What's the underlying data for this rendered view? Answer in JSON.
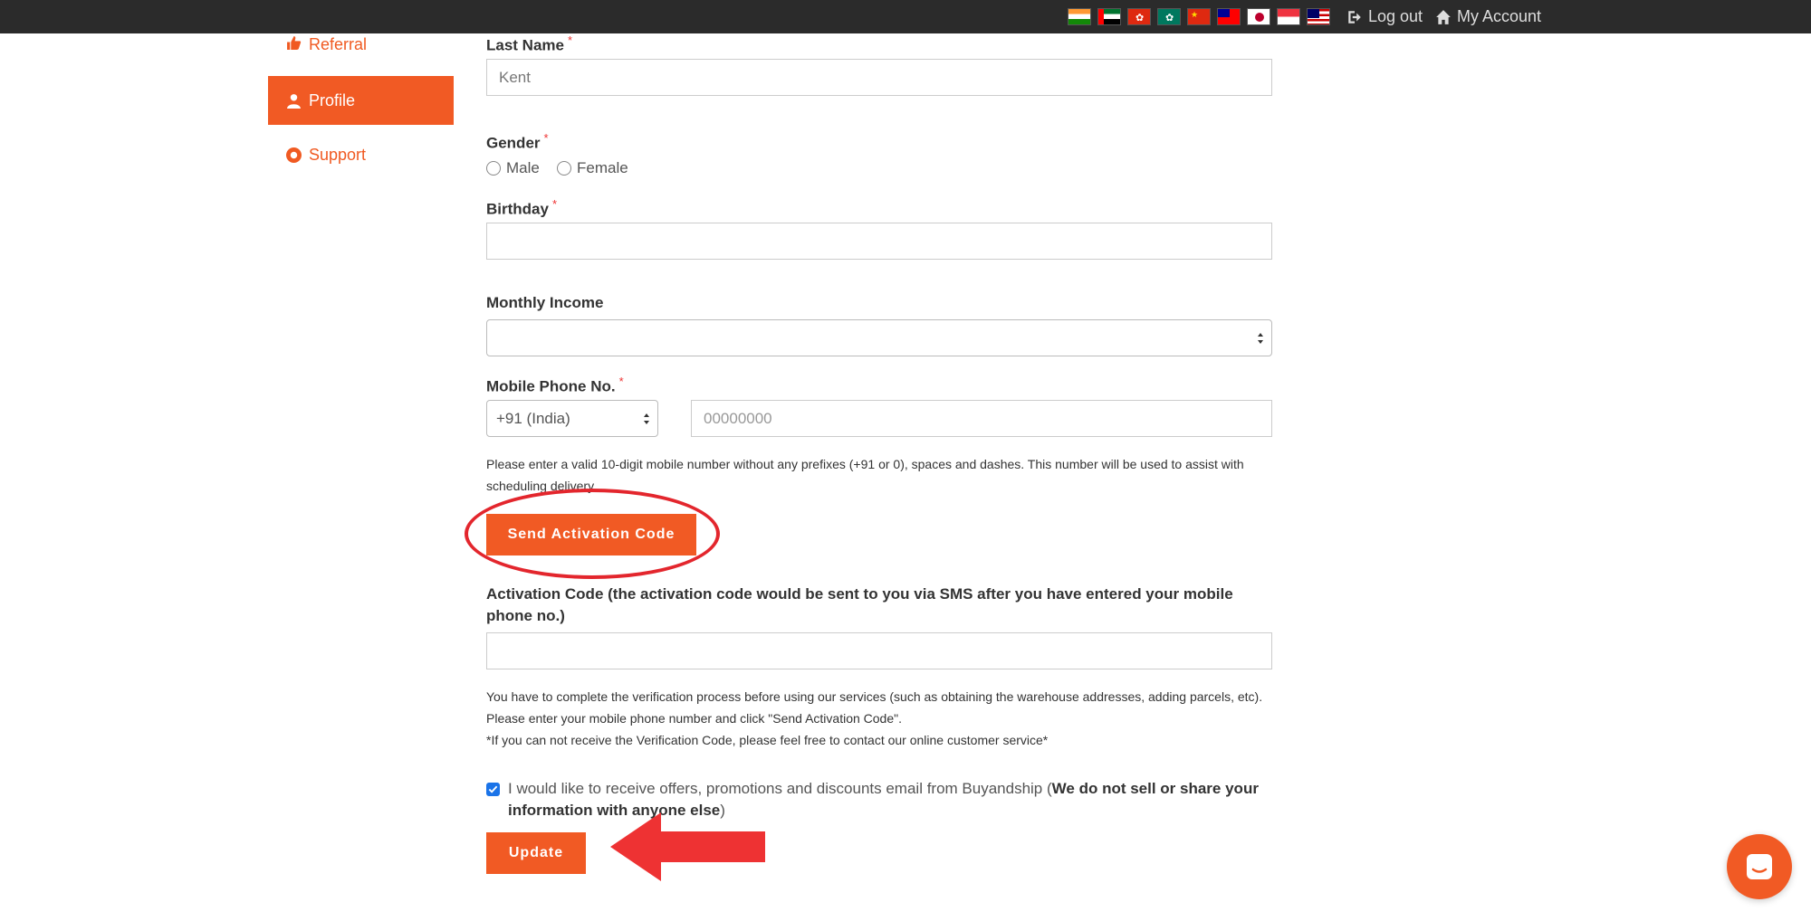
{
  "topbar": {
    "flags": [
      "flag-india-icon",
      "flag-uae-icon",
      "flag-hongkong-icon",
      "flag-macau-icon",
      "flag-china-icon",
      "flag-taiwan-icon",
      "flag-japan-icon",
      "flag-singapore-icon",
      "flag-malaysia-icon"
    ],
    "logout_label": "Log out",
    "my_account_label": "My Account"
  },
  "sidebar": {
    "items": [
      {
        "label": "Referral",
        "icon": "thumbs-up-icon"
      },
      {
        "label": "Profile",
        "icon": "user-icon",
        "active": true
      },
      {
        "label": "Support",
        "icon": "life-ring-icon"
      }
    ]
  },
  "form": {
    "last_name": {
      "label": "Last Name",
      "required": "*",
      "value": "Kent"
    },
    "gender": {
      "label": "Gender",
      "required": "*",
      "options": [
        "Male",
        "Female"
      ]
    },
    "birthday": {
      "label": "Birthday",
      "required": "*",
      "value": ""
    },
    "monthly_income": {
      "label": "Monthly Income",
      "value": ""
    },
    "mobile": {
      "label": "Mobile Phone No.",
      "required": "*",
      "country_code": "+91 (India)",
      "placeholder": "00000000",
      "help": "Please enter a valid 10-digit mobile number without any prefixes (+91 or 0), spaces and dashes. This number will be used to assist with scheduling delivery."
    },
    "send_code_button": "Send Activation Code",
    "activation_code": {
      "label": "Activation Code (the activation code would be sent to you via SMS after you have entered your mobile phone no.)",
      "value": ""
    },
    "verification_help_1": "You have to complete the verification process before using our services (such as obtaining the warehouse addresses, adding parcels, etc). Please enter your mobile phone number and click \"Send Activation Code\".",
    "verification_help_2": "*If you can not receive the Verification Code, please feel free to contact our online customer service*",
    "consent": {
      "checked": true,
      "text": "I would like to receive offers, promotions and discounts email from Buyandship (",
      "bold": "We do not sell or share your information with anyone else",
      "close": ")"
    },
    "update_button": "Update"
  },
  "colors": {
    "accent": "#f15a24",
    "topbar": "#2b2b2b",
    "annotation": "#e3262d"
  }
}
